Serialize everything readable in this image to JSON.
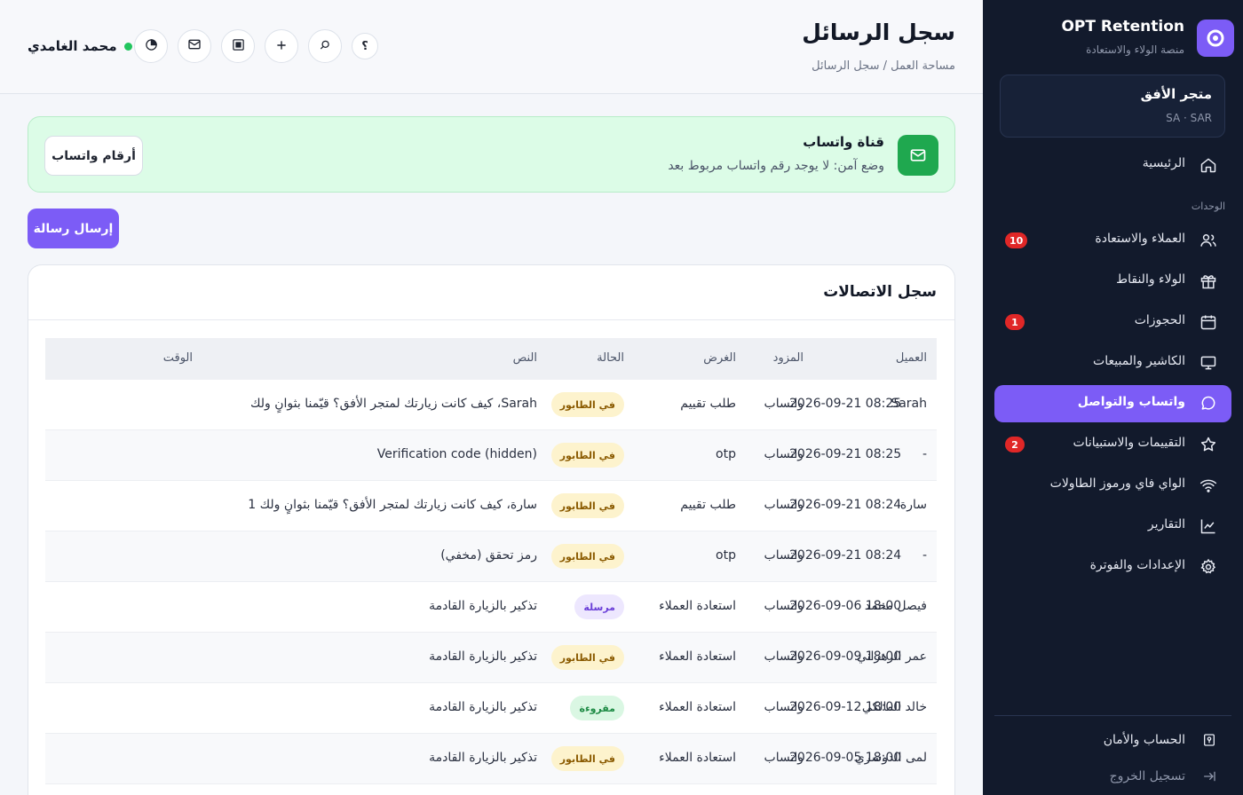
{
  "brand": {
    "title": "OPT Retention",
    "subtitle": "منصة الولاء والاستعادة"
  },
  "store": {
    "name": "متجر الأفق",
    "meta": "SA · SAR"
  },
  "nav": {
    "home": "الرئيسية",
    "section_label": "الوحدات",
    "items": [
      {
        "label": "العملاء والاستعادة",
        "icon": "users-icon",
        "badge": "10"
      },
      {
        "label": "الولاء والنقاط",
        "icon": "gift-icon"
      },
      {
        "label": "الحجوزات",
        "icon": "calendar-icon",
        "badge": "1"
      },
      {
        "label": "الكاشير والمبيعات",
        "icon": "monitor-icon"
      },
      {
        "label": "واتساب والتواصل",
        "icon": "chat-icon",
        "active": true
      },
      {
        "label": "التقييمات والاستبيانات",
        "icon": "star-icon",
        "badge": "2"
      },
      {
        "label": "الواي فاي ورموز الطاولات",
        "icon": "wifi-icon"
      },
      {
        "label": "التقارير",
        "icon": "chart-icon"
      },
      {
        "label": "الإعدادات والفوترة",
        "icon": "gear-icon"
      }
    ],
    "account": "الحساب والأمان",
    "logout": "تسجيل الخروج"
  },
  "header": {
    "title": "سجل الرسائل",
    "breadcrumb": "مساحة العمل / سجل الرسائل",
    "user_name": "محمد الغامدي",
    "help_glyph": "؟"
  },
  "channel": {
    "title": "قناة واتساب",
    "subtitle": "وضع آمن: لا يوجد رقم واتساب مربوط بعد",
    "numbers_button": "أرقام واتساب"
  },
  "send_button": "إرسال رسالة",
  "log": {
    "title": "سجل الاتصالات",
    "columns": {
      "client": "العميل",
      "provider": "المزود",
      "purpose": "الغرض",
      "status": "الحالة",
      "text": "النص",
      "time": "الوقت"
    },
    "rows": [
      {
        "client": "Sarah",
        "provider": "واتساب",
        "purpose": "طلب تقييم",
        "status": "في الطابور",
        "status_kind": "queued",
        "text": "Sarah، كيف كانت زيارتك لمتجر الأفق؟ قيّمنا بثوانٍ ولك",
        "time": "2026-09-21 08:25"
      },
      {
        "client": "-",
        "provider": "واتساب",
        "purpose": "otp",
        "status": "في الطابور",
        "status_kind": "queued",
        "text": "Verification code (hidden)",
        "time": "2026-09-21 08:25"
      },
      {
        "client": "سارة",
        "provider": "واتساب",
        "purpose": "طلب تقييم",
        "status": "في الطابور",
        "status_kind": "queued",
        "text": "سارة، كيف كانت زيارتك لمتجر الأفق؟ قيّمنا بثوانٍ ولك 1",
        "time": "2026-09-21 08:24"
      },
      {
        "client": "-",
        "provider": "واتساب",
        "purpose": "otp",
        "status": "في الطابور",
        "status_kind": "queued",
        "text": "رمز تحقق (مخفي)",
        "time": "2026-09-21 08:24"
      },
      {
        "client": "فيصل محمد",
        "provider": "واتساب",
        "purpose": "استعادة العملاء",
        "status": "مرسلة",
        "status_kind": "sent",
        "text": "تذكير بالزيارة القادمة",
        "time": "2026-09-06 18:00"
      },
      {
        "client": "عمر الزهراني",
        "provider": "واتساب",
        "purpose": "استعادة العملاء",
        "status": "في الطابور",
        "status_kind": "queued",
        "text": "تذكير بالزيارة القادمة",
        "time": "2026-09-09 18:00"
      },
      {
        "client": "خالد المالكي",
        "provider": "واتساب",
        "purpose": "استعادة العملاء",
        "status": "مقروءة",
        "status_kind": "read",
        "text": "تذكير بالزيارة القادمة",
        "time": "2026-09-12 18:00"
      },
      {
        "client": "لمى الدوسري",
        "provider": "واتساب",
        "purpose": "استعادة العملاء",
        "status": "في الطابور",
        "status_kind": "queued",
        "text": "تذكير بالزيارة القادمة",
        "time": "2026-09-05 18:00"
      }
    ]
  },
  "colors": {
    "accent": "#7c5cf6",
    "sidebar_bg": "#121a2c",
    "channel_bg": "#dcfce7",
    "whatsapp_green": "#1fa84f",
    "badge_red": "#e02727"
  }
}
